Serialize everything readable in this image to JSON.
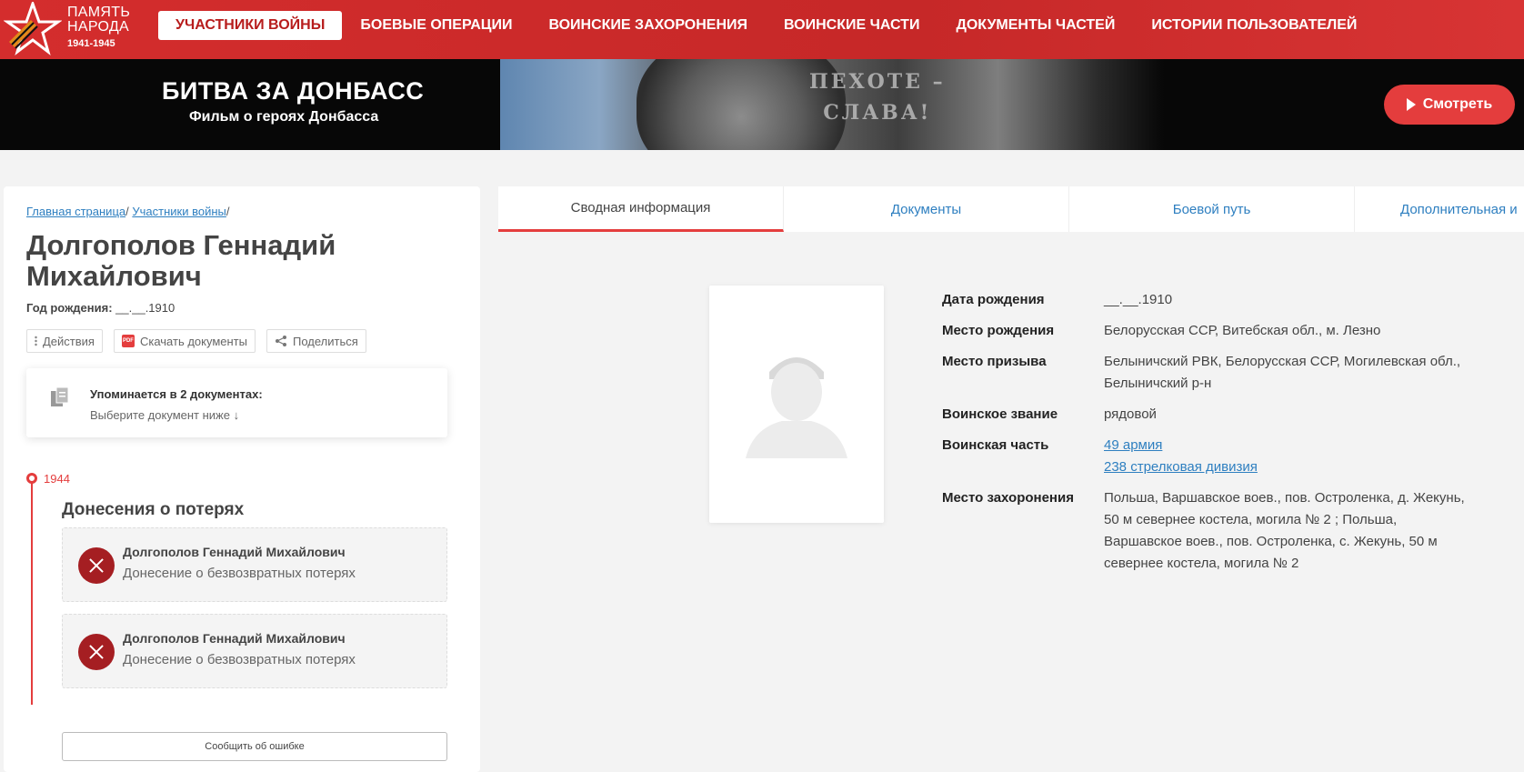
{
  "header": {
    "logo_line1": "ПАМЯТЬ",
    "logo_line2": "НАРОДА",
    "logo_years": "1941-1945",
    "nav": [
      {
        "label": "УЧАСТНИКИ ВОЙНЫ",
        "active": true
      },
      {
        "label": "БОЕВЫЕ ОПЕРАЦИИ"
      },
      {
        "label": "ВОИНСКИЕ ЗАХОРОНЕНИЯ"
      },
      {
        "label": "ВОИНСКИЕ ЧАСТИ"
      },
      {
        "label": "ДОКУМЕНТЫ ЧАСТЕЙ"
      },
      {
        "label": "ИСТОРИИ ПОЛЬЗОВАТЕЛЕЙ"
      }
    ]
  },
  "banner": {
    "title": "БИТВА ЗА ДОНБАСС",
    "subtitle": "Фильм о героях Донбасса",
    "slogan_line1": "ПЕХОТЕ –",
    "slogan_line2": "СЛАВА!",
    "watch_label": "Смотреть"
  },
  "breadcrumb": {
    "home": "Главная страница",
    "section": "Участники войны",
    "sep": "/"
  },
  "person": {
    "name": "Долгополов Геннадий Михайлович",
    "birth_label": "Год рождения:",
    "birth_value": "__.__.1910"
  },
  "actions": {
    "actions_label": "Действия",
    "download_label": "Скачать документы",
    "share_label": "Поделиться"
  },
  "mentions": {
    "title": "Упоминается в 2 документах:",
    "subtitle": "Выберите документ ниже ↓"
  },
  "timeline": {
    "year": "1944",
    "group_title": "Донесения о потерях",
    "documents": [
      {
        "name": "Долгополов Геннадий Михайлович",
        "type": "Донесение о безвозвратных потерях"
      },
      {
        "name": "Долгополов Геннадий Михайлович",
        "type": "Донесение о безвозвратных потерях"
      }
    ]
  },
  "report_error_label": "Сообщить об ошибке",
  "tabs": [
    {
      "label": "Сводная информация",
      "active": true
    },
    {
      "label": "Документы"
    },
    {
      "label": "Боевой путь"
    },
    {
      "label": "Дополнительная и"
    }
  ],
  "info": {
    "birth_date_label": "Дата рождения",
    "birth_date": "__.__.1910",
    "birth_place_label": "Место рождения",
    "birth_place": "Белорусская ССР, Витебская обл., м. Лезно",
    "draft_place_label": "Место призыва",
    "draft_place": "Белыничский РВК, Белорусская ССР, Могилевская обл., Белыничский р-н",
    "rank_label": "Воинское звание",
    "rank": "рядовой",
    "unit_label": "Воинская часть",
    "unit_1": "49 армия",
    "unit_2": "238 стрелковая дивизия",
    "burial_label": "Место захоронения",
    "burial": "Польша, Варшавское воев., пов. Остроленка, д. Жекунь, 50 м севернее костела, могила № 2 ; Польша, Варшавское воев., пов. Остроленка, с. Жекунь, 50 м севернее костела, могила № 2"
  },
  "colors": {
    "brand_red": "#d42d2d",
    "link_blue": "#2e7fc0",
    "loss_icon": "#a51e22"
  }
}
